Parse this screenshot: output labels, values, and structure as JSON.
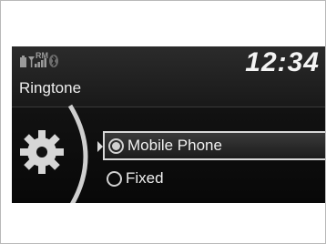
{
  "status_bar": {
    "roaming_label": "RM",
    "clock": "12:34",
    "icons": [
      "phone-battery-icon",
      "signal-strength-icon",
      "bluetooth-icon"
    ]
  },
  "screen": {
    "title": "Ringtone",
    "category_icon": "gear-icon"
  },
  "options": [
    {
      "label": "Mobile Phone",
      "selected": true
    },
    {
      "label": "Fixed",
      "selected": false
    }
  ],
  "colors": {
    "background": "#111111",
    "text": "#f0f0f0",
    "highlight_border": "#d8d8d8"
  }
}
